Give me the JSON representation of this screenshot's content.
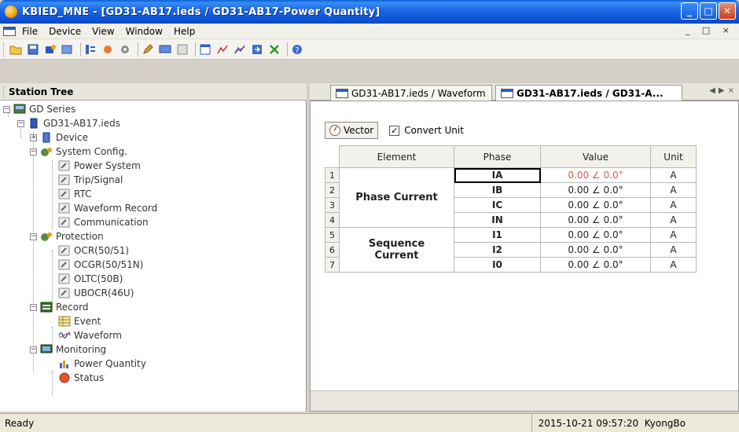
{
  "window": {
    "title": "KBIED_MNE - [GD31-AB17.ieds / GD31-AB17-Power Quantity]"
  },
  "menu": {
    "items": [
      "File",
      "Device",
      "View",
      "Window",
      "Help"
    ],
    "mdi_buttons": "_ š ×"
  },
  "left_panel": {
    "title": "Station Tree"
  },
  "tree": {
    "root": "GD Series",
    "device_file": "GD31-AB17.ieds",
    "device": "Device",
    "system_config": "System Config.",
    "power_system": "Power System",
    "trip_signal": "Trip/Signal",
    "rtc": "RTC",
    "waveform_record": "Waveform Record",
    "communication": "Communication",
    "protection": "Protection",
    "ocr": "OCR(50/51)",
    "ocgr": "OCGR(50/51N)",
    "oltc": "OLTC(50B)",
    "ubocr": "UBOCR(46U)",
    "record": "Record",
    "event": "Event",
    "waveform": "Waveform",
    "monitoring": "Monitoring",
    "power_quantity": "Power Quantity",
    "status": "Status"
  },
  "tabs": [
    {
      "label": "GD31-AB17.ieds / Waveform"
    },
    {
      "label": "GD31-AB17.ieds / GD31-A..."
    }
  ],
  "toolbar_view": {
    "vector_label": "Vector",
    "convert_unit_label": "Convert Unit",
    "convert_unit_checked": true
  },
  "table": {
    "headers": {
      "element": "Element",
      "phase": "Phase",
      "value": "Value",
      "unit": "Unit"
    },
    "groups": {
      "phase_current": "Phase Current",
      "sequence_current": "Sequence Current"
    },
    "rows": [
      {
        "num": "1",
        "phase": "IA",
        "value": "0.00 ∠ 0.0°",
        "unit": "A"
      },
      {
        "num": "2",
        "phase": "IB",
        "value": "0.00 ∠ 0.0°",
        "unit": "A"
      },
      {
        "num": "3",
        "phase": "IC",
        "value": "0.00 ∠ 0.0°",
        "unit": "A"
      },
      {
        "num": "4",
        "phase": "IN",
        "value": "0.00 ∠ 0.0°",
        "unit": "A"
      },
      {
        "num": "5",
        "phase": "I1",
        "value": "0.00 ∠ 0.0°",
        "unit": "A"
      },
      {
        "num": "6",
        "phase": "I2",
        "value": "0.00 ∠ 0.0°",
        "unit": "A"
      },
      {
        "num": "7",
        "phase": "I0",
        "value": "0.00 ∠ 0.0°",
        "unit": "A"
      }
    ]
  },
  "statusbar": {
    "left": "Ready",
    "datetime": "2015-10-21 09:57:20",
    "user": "KyongBo"
  },
  "colors": {
    "title_bar": "#1d6ae6",
    "selected_value": "#e05555",
    "group_label": "#1c3a6a"
  },
  "icons": [
    "app-icon",
    "document-icon",
    "open-folder-icon",
    "save-icon",
    "device-icon",
    "settings-gear-icon",
    "vector-icon",
    "check-icon"
  ]
}
